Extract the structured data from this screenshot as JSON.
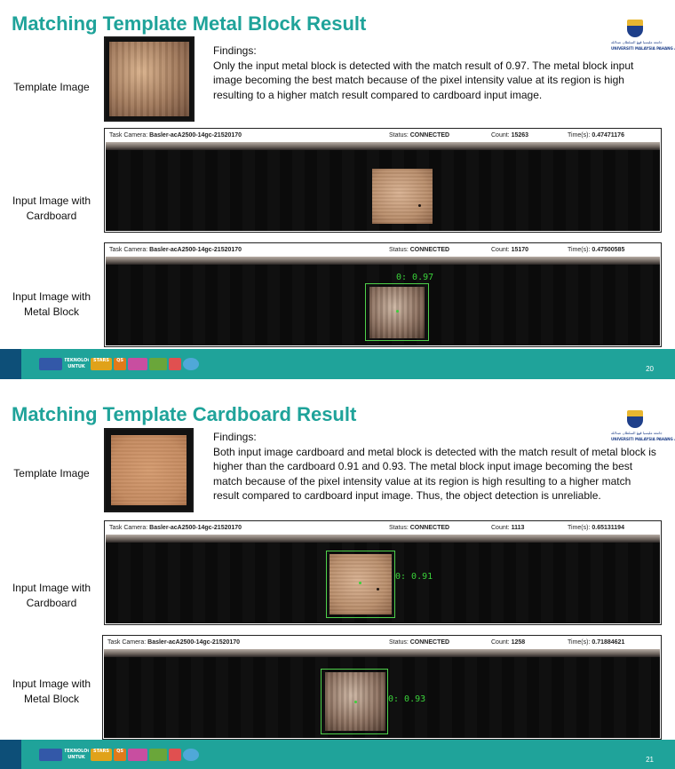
{
  "slides": [
    {
      "title": "Matching Template Metal Block Result",
      "logo": {
        "line1": "جامعة مليسيا ڤهڠ السلطان عبدالله",
        "line2": "UNIVERSITI MALAYSIA PAHANG AL-SULTAN ABDULLAH"
      },
      "template_label": "Template Image",
      "findings_heading": "Findings:",
      "findings_body": "Only the input metal block is detected with the match result of 0.97. The metal block input image becoming the best match because of the pixel intensity value at its region is high resulting to a higher match result compared to cardboard input image.",
      "panels": [
        {
          "label": "Input Image with Cardboard",
          "camera_caption": "Task Camera:",
          "camera_name": "Basler-acA2500-14gc-21520170",
          "status_caption": "Status:",
          "status_value": "CONNECTED",
          "count_caption": "Count:",
          "count_value": "15263",
          "time_caption": "Time(s):",
          "time_value": "0.47471176",
          "match_label": ""
        },
        {
          "label": "Input Image with Metal Block",
          "camera_caption": "Task Camera:",
          "camera_name": "Basler-acA2500-14gc-21520170",
          "status_caption": "Status:",
          "status_value": "CONNECTED",
          "count_caption": "Count:",
          "count_value": "15170",
          "time_caption": "Time(s):",
          "time_value": "0.47500585",
          "match_label": "0: 0.97"
        }
      ],
      "footer": {
        "badge1": "TEKNOLOGI UNTUK MASYARAKAT",
        "badge2": "STARS",
        "badge3": "QS",
        "page_number": "20"
      }
    },
    {
      "title": "Matching Template Cardboard Result",
      "logo": {
        "line1": "جامعة مليسيا ڤهڠ السلطان عبدالله",
        "line2": "UNIVERSITI MALAYSIA PAHANG AL-SULTAN ABDULLAH"
      },
      "template_label": "Template Image",
      "findings_heading": "Findings:",
      "findings_body": "Both input image cardboard and metal block is detected with the match result of metal block is higher than the cardboard 0.91 and 0.93. The metal block input image becoming the best match because of the pixel intensity value at its region is high resulting  to a higher match result compared to cardboard input image. Thus, the object detection is unreliable.",
      "panels": [
        {
          "label": "Input Image with Cardboard",
          "camera_caption": "Task Camera:",
          "camera_name": "Basler-acA2500-14gc-21520170",
          "status_caption": "Status:",
          "status_value": "CONNECTED",
          "count_caption": "Count:",
          "count_value": "1113",
          "time_caption": "Time(s):",
          "time_value": "0.65131194",
          "match_label": "0: 0.91"
        },
        {
          "label": "Input Image with Metal Block",
          "camera_caption": "Task Camera:",
          "camera_name": "Basler-acA2500-14gc-21520170",
          "status_caption": "Status:",
          "status_value": "CONNECTED",
          "count_caption": "Count:",
          "count_value": "1258",
          "time_caption": "Time(s):",
          "time_value": "0.71884621",
          "match_label": "0: 0.93"
        }
      ],
      "footer": {
        "badge1": "TEKNOLOGI UNTUK MASYARAKAT",
        "badge2": "STARS",
        "badge3": "QS",
        "page_number": "21"
      }
    }
  ],
  "colors": {
    "title": "#1fa39a",
    "footer_teal": "#1fa39a",
    "footer_navy": "#0d4f78",
    "detection_box": "#4fd14a"
  }
}
